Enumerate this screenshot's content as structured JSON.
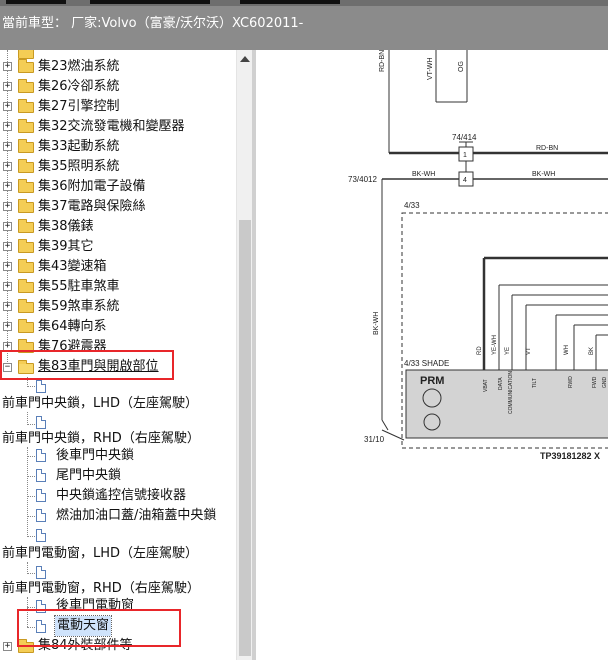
{
  "header": {
    "vehicle_label": "當前車型：  厂家:Volvo（富豪/沃尔沃）XC602011-"
  },
  "tree": {
    "groups": [
      {
        "label": "集23燃油系統"
      },
      {
        "label": "集26冷卻系統"
      },
      {
        "label": "集27引擎控制"
      },
      {
        "label": "集32交流發電機和變壓器"
      },
      {
        "label": "集33起動系統"
      },
      {
        "label": "集35照明系統"
      },
      {
        "label": "集36附加電子設備"
      },
      {
        "label": "集37電路與保險絲"
      },
      {
        "label": "集38儀錶"
      },
      {
        "label": "集39其它"
      },
      {
        "label": "集43變速箱"
      },
      {
        "label": "集55駐車煞車"
      },
      {
        "label": "集59煞車系統"
      },
      {
        "label": "集64轉向系"
      },
      {
        "label": "集76避震器"
      }
    ],
    "open_group": {
      "label": "集83車門與開啟部位"
    },
    "subitems": {
      "front_lock_lhd": "前車門中央鎖，LHD（左座駕駛）",
      "front_lock_rhd": "前車門中央鎖，RHD（右座駕駛）",
      "rear_door_lock": "後車門中央鎖",
      "tailgate_lock": "尾門中央鎖",
      "remote_receiver": "中央鎖遙控信號接收器",
      "fuel_cap_lock": "燃油加油口蓋/油箱蓋中央鎖",
      "front_window_lhd": "前車門電動窗，LHD（左座駕駛）",
      "front_window_rhd": "前車門電動窗，RHD（右座駕駛）",
      "rear_window": "後車門電動窗",
      "sunroof": "電動天窗"
    },
    "last_group": {
      "label": "集84外裝部件等"
    }
  },
  "diagram": {
    "wires": {
      "rd_bn": "RD-BN",
      "vt_wh": "VT-WH",
      "og": "OG",
      "bk_wh": "BK-WH",
      "ye_wh": "YE-WH",
      "ye": "YE",
      "vt": "VT",
      "wh": "WH",
      "bk": "BK",
      "rd": "RD"
    },
    "connector_74": "74/414",
    "connector_73": "73/4012",
    "pin1": "1",
    "pin4": "4",
    "box_433": "4/33",
    "shade_label": "4/33 SHADE",
    "prm": "PRM",
    "pins": [
      "VBAT",
      "DATA",
      "COMMUNICATION",
      "TILT",
      "RWD",
      "FWD",
      "GND"
    ],
    "ground": "31/10",
    "ref_code": "TP39181282 X"
  },
  "colors": {
    "highlight": "#e8262a",
    "header_bg": "#8b8b8b",
    "wire": "#333333"
  }
}
